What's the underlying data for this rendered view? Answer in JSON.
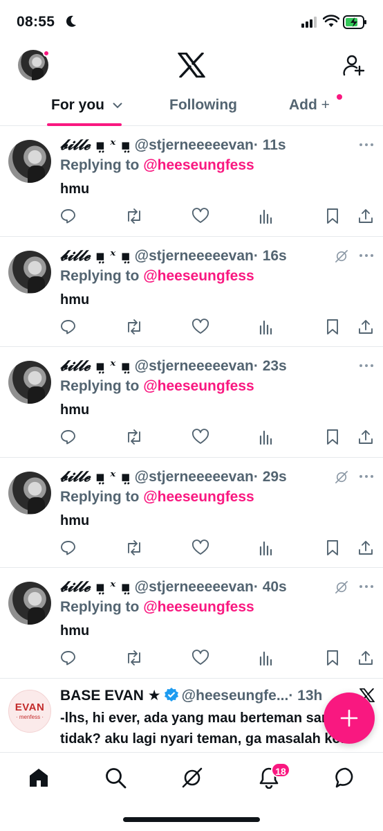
{
  "status_bar": {
    "time": "08:55"
  },
  "header": {
    "logo": "x-logo-icon",
    "tabs": [
      {
        "label": "For you",
        "active": true
      },
      {
        "label": "Following",
        "active": false
      },
      {
        "label": "Add",
        "active": false
      }
    ]
  },
  "posts": [
    {
      "display_name": "𝓫𝓲𝓵𝓵𝓮 ▪̤ ˣ ▪̤",
      "handle": "@stjerneeeeevan",
      "time": "· 11s",
      "replying_label": "Replying to",
      "replying_to": "@heeseungfess",
      "text": "hmu",
      "grok": false
    },
    {
      "display_name": "𝓫𝓲𝓵𝓵𝓮 ▪̤ ˣ ▪̤",
      "handle": "@stjerneeeeevan",
      "time": "· 16s",
      "replying_label": "Replying to",
      "replying_to": "@heeseungfess",
      "text": "hmu",
      "grok": true
    },
    {
      "display_name": "𝓫𝓲𝓵𝓵𝓮 ▪̤ ˣ ▪̤",
      "handle": "@stjerneeeeevan",
      "time": "· 23s",
      "replying_label": "Replying to",
      "replying_to": "@heeseungfess",
      "text": "hmu",
      "grok": false
    },
    {
      "display_name": "𝓫𝓲𝓵𝓵𝓮 ▪̤ ˣ ▪̤",
      "handle": "@stjerneeeeevan",
      "time": "· 29s",
      "replying_label": "Replying to",
      "replying_to": "@heeseungfess",
      "text": "hmu",
      "grok": true
    },
    {
      "display_name": "𝓫𝓲𝓵𝓵𝓮 ▪̤ ˣ ▪̤",
      "handle": "@stjerneeeeevan",
      "time": "· 40s",
      "replying_label": "Replying to",
      "replying_to": "@heeseungfess",
      "text": "hmu",
      "grok": true
    }
  ],
  "last_post": {
    "avatar_text": "EVAN",
    "avatar_subtext": "· menfess ·",
    "display_name": "BASE EVAN ★",
    "handle": "@heeseungfe...",
    "time": "· 13h",
    "text": "-lhs, hi ever, ada yang mau berteman sama aku tidak? aku lagi nyari teman, ga masalah kok kalau mulfand — adeknya kak hee"
  },
  "bottom_nav": {
    "notifications_badge": "18"
  },
  "colors": {
    "accent": "#f91880",
    "text": "#0f1419",
    "secondary": "#536471",
    "verified": "#1d9bf0"
  }
}
